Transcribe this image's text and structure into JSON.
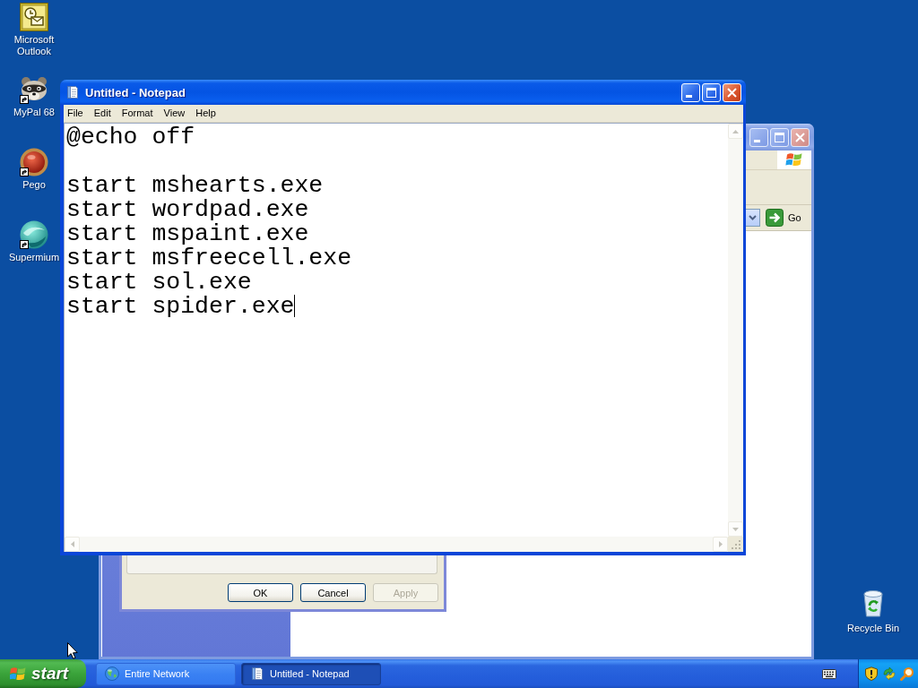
{
  "desktop_icons": [
    {
      "kind": "outlook",
      "label": "Microsoft Outlook",
      "shortcut": false
    },
    {
      "kind": "mypal",
      "label": "MyPal 68",
      "shortcut": true
    },
    {
      "kind": "pego",
      "label": "Pego",
      "shortcut": true
    },
    {
      "kind": "supermium",
      "label": "Supermium",
      "shortcut": true
    }
  ],
  "explorer_window": {
    "active": false,
    "go_button": "Go"
  },
  "properties_dialog": {
    "buttons": [
      {
        "label": "OK",
        "disabled": false
      },
      {
        "label": "Cancel",
        "disabled": false
      },
      {
        "label": "Apply",
        "disabled": true
      }
    ]
  },
  "notepad": {
    "active": true,
    "title": "Untitled - Notepad",
    "menu": [
      "File",
      "Edit",
      "Format",
      "View",
      "Help"
    ],
    "text": "@echo off\n\nstart mshearts.exe\nstart wordpad.exe\nstart mspaint.exe\nstart msfreecell.exe\nstart sol.exe\nstart spider.exe"
  },
  "recycle_bin": {
    "label": "Recycle Bin"
  },
  "taskbar": {
    "start_button": "start",
    "tasks": [
      {
        "kind": "network",
        "label": "Entire Network",
        "selected": false
      },
      {
        "kind": "notepad",
        "label": "Untitled - Notepad",
        "selected": true
      }
    ]
  }
}
